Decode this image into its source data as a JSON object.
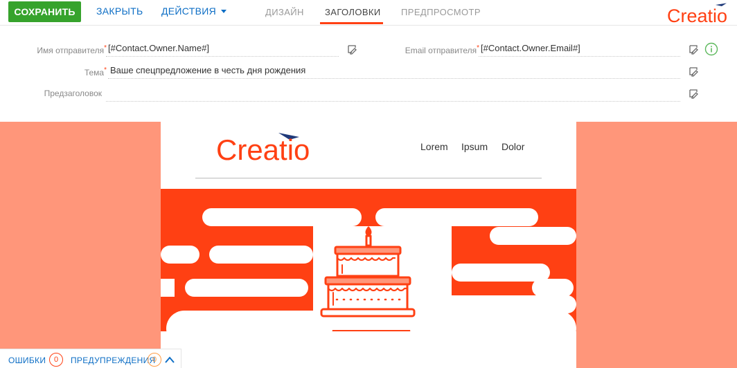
{
  "toolbar": {
    "save_label": "СОХРАНИТЬ",
    "close_label": "ЗАКРЫТЬ",
    "actions_label": "ДЕЙСТВИЯ"
  },
  "tabs": [
    {
      "label": "ДИЗАЙН",
      "active": false
    },
    {
      "label": "ЗАГОЛОВКИ",
      "active": true
    },
    {
      "label": "ПРЕДПРОСМОТР",
      "active": false
    }
  ],
  "brand": {
    "logo_text": "Creatio",
    "accent": "#ff4013",
    "arrow_color": "#1f3a7a"
  },
  "form": {
    "sender_name": {
      "label": "Имя отправителя",
      "value": "[#Contact.Owner.Name#]"
    },
    "sender_email": {
      "label": "Email отправителя",
      "value": "[#Contact.Owner.Email#]"
    },
    "subject": {
      "label": "Тема",
      "value": "Ваше спецпредложение в честь дня рождения"
    },
    "preheader": {
      "label": "Предзаголовок",
      "value": ""
    }
  },
  "email_preview": {
    "logo_text": "Creatio",
    "nav": [
      "Lorem",
      "Ipsum",
      "Dolor"
    ],
    "canvas_color": "#ff967a",
    "hero_color": "#ff4013",
    "hero_icon": "birthday-cake-icon"
  },
  "status_bar": {
    "errors_label": "ОШИБКИ",
    "errors_count": "0",
    "warnings_label": "ПРЕДУПРЕЖДЕНИЯ",
    "warnings_count": "0"
  },
  "icons": {
    "macro": "macro-icon",
    "info": "info-icon",
    "collapse": "chevron-up-icon"
  }
}
